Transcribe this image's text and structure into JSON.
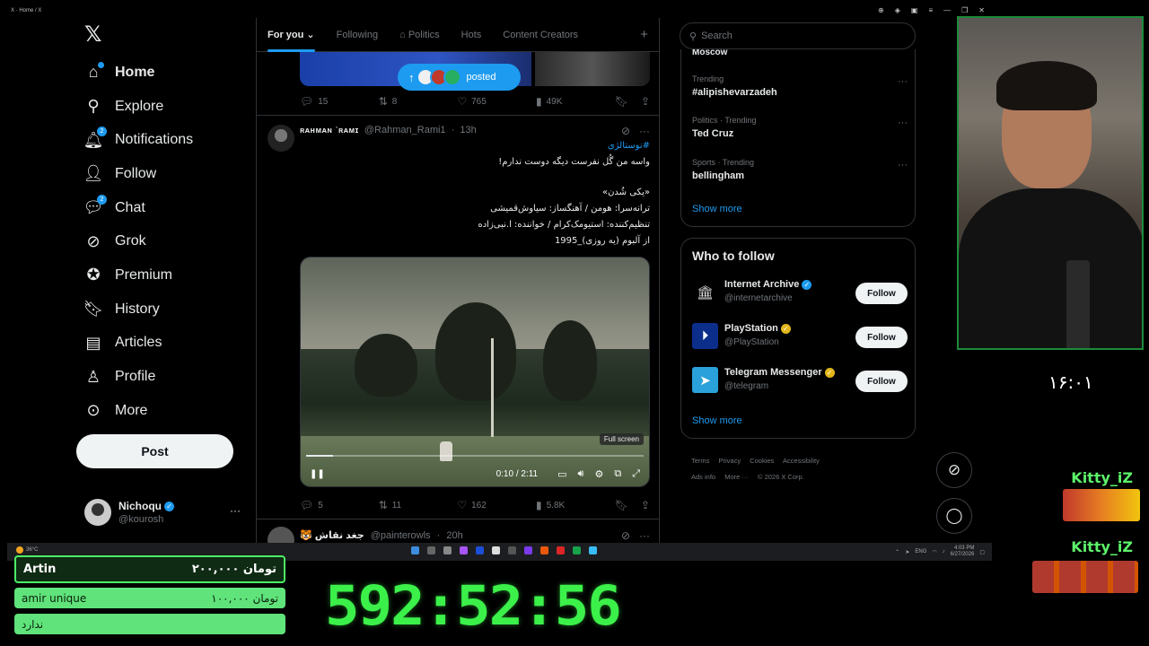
{
  "window": {
    "tab_title": "X · Home / X"
  },
  "nav": {
    "items": [
      {
        "label": "Home",
        "icon": "home-icon"
      },
      {
        "label": "Explore",
        "icon": "search-icon"
      },
      {
        "label": "Notifications",
        "icon": "bell-icon",
        "badge": "2"
      },
      {
        "label": "Follow",
        "icon": "add-person-icon"
      },
      {
        "label": "Chat",
        "icon": "chat-icon",
        "badge": "2"
      },
      {
        "label": "Grok",
        "icon": "grok-icon"
      },
      {
        "label": "Premium",
        "icon": "premium-icon"
      },
      {
        "label": "History",
        "icon": "bookmark-icon"
      },
      {
        "label": "Articles",
        "icon": "articles-icon"
      },
      {
        "label": "Profile",
        "icon": "person-icon"
      },
      {
        "label": "More",
        "icon": "more-circle-icon"
      }
    ],
    "post_label": "Post"
  },
  "account": {
    "name": "Nichoqu",
    "handle": "@kourosh"
  },
  "tabs": [
    "For you",
    "Following",
    "Politics",
    "Hots",
    "Content Creators"
  ],
  "feed": {
    "posted_label": "posted",
    "tweet1_stats": {
      "replies": "15",
      "reposts": "8",
      "likes": "765",
      "views": "49K"
    },
    "tweet2": {
      "name": "ʀᴀʜᴍᴀɴ ˋʀᴀᴍɪ",
      "handle": "@Rahman_Rami1",
      "time": "13h",
      "hashtag": "#نوستالژی",
      "line1": "واسه من گُل نفرست دیگه دوست ندارم!",
      "line2": "«یکی شُدن»",
      "line3": "ترانه‌سرا: هومن / آهنگساز: سیاوش‌قمیشی",
      "line4": "تنظیم‌کننده: استیومک‌کرام / خواننده: ا.نبی‌زاده",
      "line5": "از آلبوم (یه روزی)_1995",
      "video": {
        "fullscreen_tip": "Full screen",
        "time": "0:10 / 2:11",
        "progress": 0.08
      },
      "stats": {
        "replies": "5",
        "reposts": "11",
        "likes": "162",
        "views": "5.8K"
      }
    },
    "tweet3": {
      "name": "🐯 جغد نقاش",
      "handle": "@painterowls",
      "time": "20h"
    }
  },
  "search": {
    "placeholder": "Search"
  },
  "trends": {
    "top_cut": "Moscow",
    "items": [
      {
        "category": "Trending",
        "topic": "#alipishevarzadeh"
      },
      {
        "category": "Politics · Trending",
        "topic": "Ted Cruz"
      },
      {
        "category": "Sports · Trending",
        "topic": "bellingham"
      }
    ],
    "show_more": "Show more"
  },
  "who_to_follow": {
    "title": "Who to follow",
    "items": [
      {
        "name": "Internet Archive",
        "handle": "@internetarchive",
        "badge": "blue"
      },
      {
        "name": "PlayStation",
        "handle": "@PlayStation",
        "badge": "gold"
      },
      {
        "name": "Telegram Messenger",
        "handle": "@telegram",
        "badge": "gold"
      }
    ],
    "follow_label": "Follow",
    "show_more": "Show more"
  },
  "footer": {
    "links": [
      "Terms",
      "Privacy",
      "Cookies",
      "Accessibility",
      "Ads info",
      "More ···"
    ],
    "copyright": "© 2026 X Corp."
  },
  "taskbar": {
    "weather": "36°C",
    "lang": "ENG",
    "time": "4:03 PM",
    "date": "6/27/2026"
  },
  "stream": {
    "clock": "۱۶:۰۱",
    "donors": [
      "Kitty_iZ",
      "Kitty_iZ"
    ],
    "donations": [
      {
        "name": "Artin",
        "amount": "تومان ۲۰۰,۰۰۰"
      },
      {
        "name": "amir unique",
        "amount": "تومان ۱۰۰,۰۰۰"
      },
      {
        "name": "ندارد",
        "amount": ""
      }
    ],
    "timer": "592:52:56"
  },
  "colors": {
    "accent": "#1d9bf0",
    "background": "#000000",
    "stream_green": "#3cf04a"
  }
}
